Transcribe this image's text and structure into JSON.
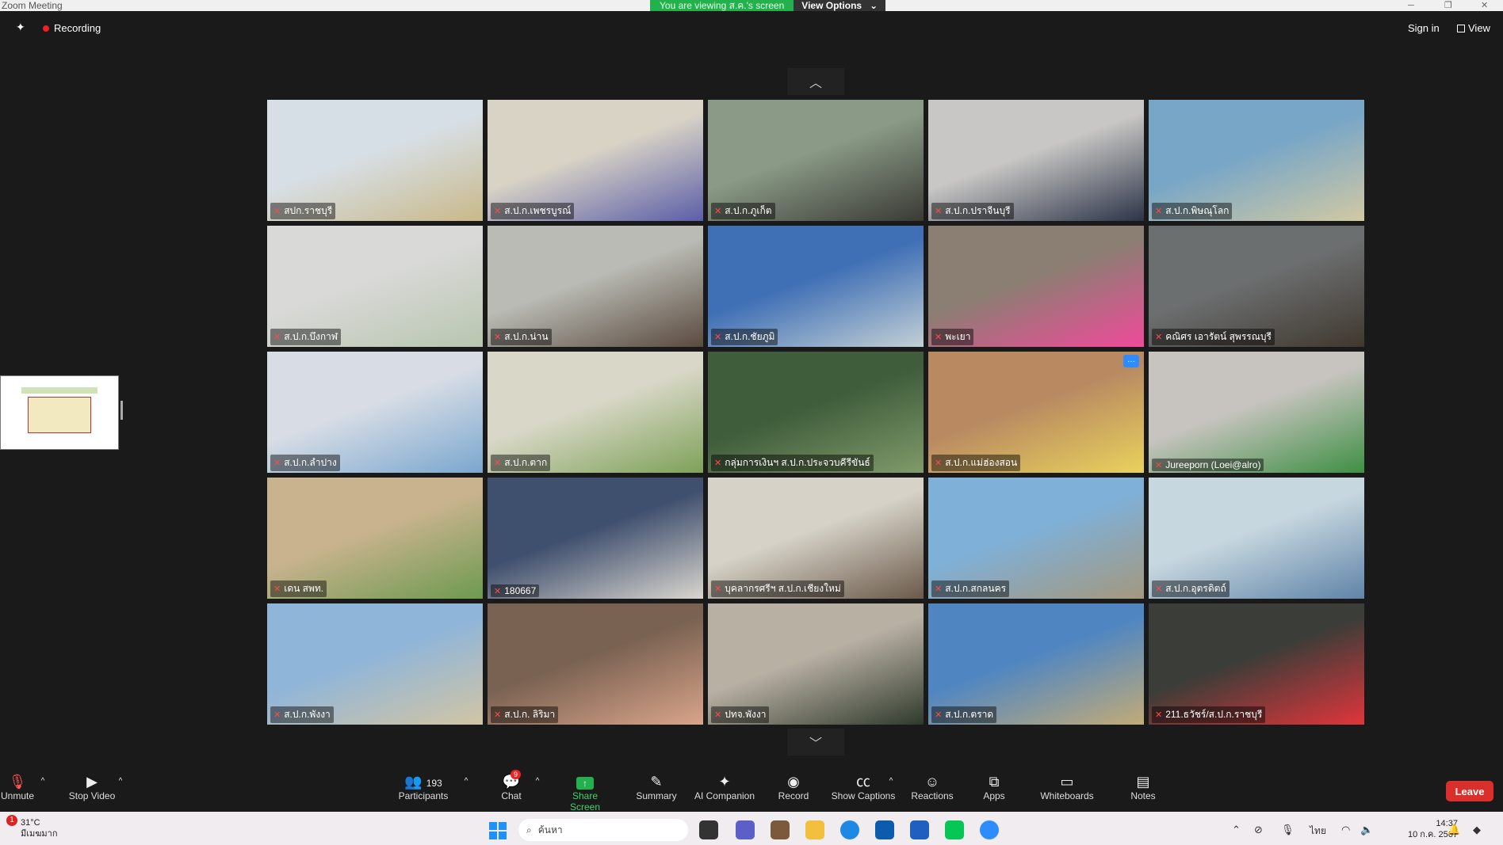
{
  "window": {
    "title": "Zoom Meeting",
    "share_banner": "You are viewing ส.ค.'s screen",
    "view_options": "View Options"
  },
  "top": {
    "recording": "Recording",
    "sign_in": "Sign in",
    "view": "View"
  },
  "participants_grid": [
    {
      "name": "สปก.ราชบุรี",
      "scene": [
        "#d7dfe6",
        "#c9b98a"
      ]
    },
    {
      "name": "ส.ป.ก.เพชรบูรณ์",
      "scene": [
        "#d9d3c6",
        "#5b5ea8"
      ]
    },
    {
      "name": "ส.ป.ก.ภูเก็ต",
      "scene": [
        "#8a9a86",
        "#3a3a35"
      ]
    },
    {
      "name": "ส.ป.ก.ปราจีนบุรี",
      "scene": [
        "#c8c7c5",
        "#2d3448"
      ]
    },
    {
      "name": "ส.ป.ก.พิษณุโลก",
      "scene": [
        "#78a6c7",
        "#d1c9a4"
      ]
    },
    {
      "name": "ส.ป.ก.บึงกาฬ",
      "scene": [
        "#d9d9d7",
        "#b8c6b0"
      ]
    },
    {
      "name": "ส.ป.ก.น่าน",
      "scene": [
        "#b9bbb4",
        "#5a4a3f"
      ]
    },
    {
      "name": "ส.ป.ก.ชัยภูมิ",
      "scene": [
        "#3f6fb5",
        "#c2d0d6"
      ]
    },
    {
      "name": "พะเยา",
      "scene": [
        "#8b7e72",
        "#f04a9a"
      ]
    },
    {
      "name": "คณิศร เอารัตน์ สุพรรณบุรี",
      "scene": [
        "#6c6f70",
        "#40382f"
      ]
    },
    {
      "name": "ส.ป.ก.ลำปาง",
      "scene": [
        "#d8dde5",
        "#7aa7cf"
      ]
    },
    {
      "name": "ส.ป.ก.ตาก",
      "scene": [
        "#d9d8c8",
        "#7ea158"
      ]
    },
    {
      "name": "กลุ่มการเงินฯ ส.ป.ก.ประจวบคีรีขันธ์",
      "scene": [
        "#3f5c3b",
        "#7f9b6a"
      ]
    },
    {
      "name": "ส.ป.ก.แม่ฮ่องสอน",
      "scene": [
        "#b98a62",
        "#e9d25c"
      ]
    },
    {
      "name": "Jureeporn (Loei@alro)",
      "scene": [
        "#c7c4bf",
        "#3f8f44"
      ]
    },
    {
      "name": "เดน สพท.",
      "scene": [
        "#c9b38e",
        "#6d9a50"
      ]
    },
    {
      "name": "180667",
      "scene": [
        "#3f4f6e",
        "#d9d6cf"
      ]
    },
    {
      "name": "บุคลากรศรีฯ ส.ป.ก.เชียงใหม่",
      "scene": [
        "#d6d2c8",
        "#6b5a4a"
      ]
    },
    {
      "name": "ส.ป.ก.สกลนคร",
      "scene": [
        "#7fb0d8",
        "#a4987e"
      ]
    },
    {
      "name": "ส.ป.ก.อุตรดิตถ์",
      "scene": [
        "#c7d7df",
        "#5f84a8"
      ]
    },
    {
      "name": "ส.ป.ก.พังงา",
      "scene": [
        "#8fb5d9",
        "#d2c5a5"
      ]
    },
    {
      "name": "ส.ป.ก. ลิริมา",
      "scene": [
        "#7a6252",
        "#d9a48a"
      ]
    },
    {
      "name": "ปทจ.พังงา",
      "scene": [
        "#b9b0a4",
        "#2f3a2c"
      ]
    },
    {
      "name": "ส.ป.ก.ตราด",
      "scene": [
        "#4f86c2",
        "#c2ab78"
      ]
    },
    {
      "name": "211.ธวัชร์/ส.ป.ก.ราชบุรี",
      "scene": [
        "#3b3d38",
        "#e0353b"
      ]
    }
  ],
  "toolbar": {
    "unmute": "Unmute",
    "stop_video": "Stop Video",
    "participants_count": "193",
    "participants": "Participants",
    "chat_badge": "9",
    "chat": "Chat",
    "share_screen": "Share Screen",
    "summary": "Summary",
    "ai_companion": "AI Companion",
    "record": "Record",
    "show_captions": "Show Captions",
    "reactions": "Reactions",
    "apps": "Apps",
    "whiteboards": "Whiteboards",
    "notes": "Notes",
    "leave": "Leave"
  },
  "taskbar": {
    "weather_badge": "1",
    "temperature": "31°C",
    "weather_text": "มีเมฆมาก",
    "search_placeholder": "ค้นหา",
    "language": "ไทย",
    "time": "14:37",
    "date": "10 ก.ค. 2567"
  },
  "colors": {
    "accent_green": "#22b14c",
    "leave_red": "#d9302c",
    "zoom_blue": "#2d8cff"
  }
}
